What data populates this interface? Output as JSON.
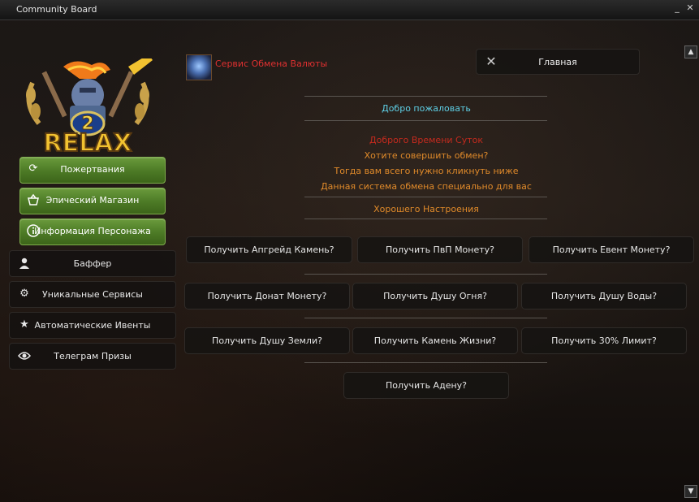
{
  "window": {
    "title": "Community Board"
  },
  "logo": {
    "number": "2",
    "text": "RELAX"
  },
  "sidebar": {
    "green_items": [
      {
        "label": "Пожертвания",
        "icon": "refresh-icon"
      },
      {
        "label": "Эпический Магазин",
        "icon": "basket-icon"
      },
      {
        "label": "Информация Персонажа",
        "icon": "info-icon"
      }
    ],
    "dark_items": [
      {
        "label": "Баффер",
        "icon": "user-icon"
      },
      {
        "label": "Уникальные Сервисы",
        "icon": "gear-icon"
      },
      {
        "label": "Автоматические Ивенты",
        "icon": "star-icon"
      },
      {
        "label": "Телеграм Призы",
        "icon": "eye-icon"
      }
    ]
  },
  "header": {
    "service_title": "Сервис Обмена Валюты",
    "home_label": "Главная"
  },
  "content": {
    "welcome": "Добро пожаловать",
    "greeting": "Доброго Времени Суток",
    "line1": "Хотите совершить обмен?",
    "line2": "Тогда вам всего нужно кликнуть ниже",
    "line3": "Данная система обмена специально для вас",
    "mood": "Хорошего Настроения",
    "colors": {
      "welcome": "#5fd0e6",
      "greeting": "#c42a1e",
      "orange": "#e08a2a"
    }
  },
  "actions": {
    "row1": [
      "Получить Апгрейд Камень?",
      "Получить ПвП Монету?",
      "Получить Евент Монету?"
    ],
    "row2": [
      "Получить Донат Монету?",
      "Получить Душу Огня?",
      "Получить Душу Воды?"
    ],
    "row3": [
      "Получить Душу Земли?",
      "Получить Камень Жизни?",
      "Получить 30% Лимит?"
    ],
    "row4": [
      "Получить Адену?"
    ]
  }
}
